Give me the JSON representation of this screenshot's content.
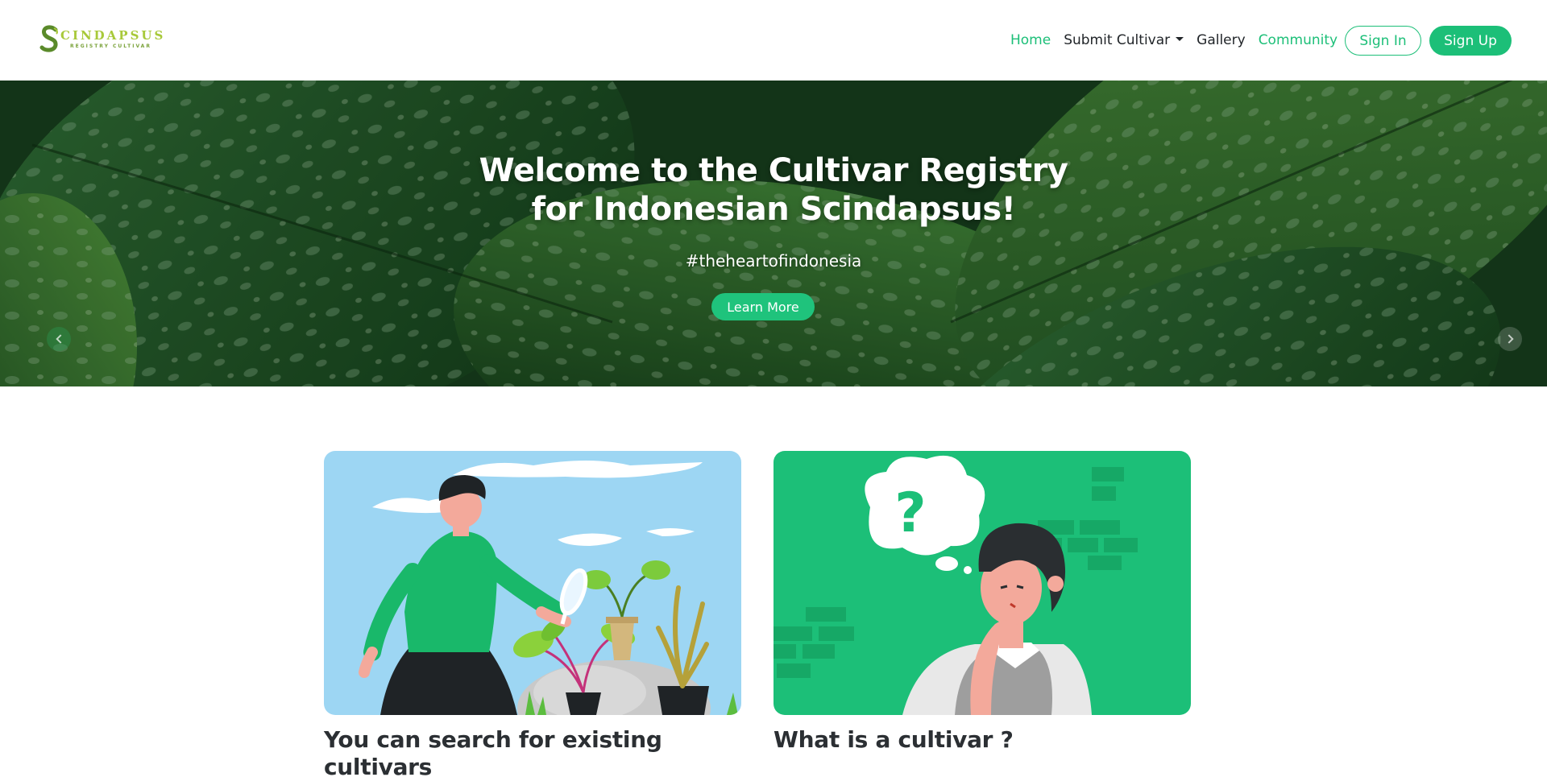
{
  "brand": {
    "name": "SCINDAPSUS",
    "word": "CINDAPSUS",
    "subtitle": "REGISTRY CULTIVAR",
    "accent": "#1cbf78",
    "logo_green": "#a8c93a"
  },
  "nav": {
    "home": "Home",
    "submit_cultivar": "Submit Cultivar",
    "gallery": "Gallery",
    "community": "Community",
    "sign_in": "Sign In",
    "sign_up": "Sign Up"
  },
  "hero": {
    "title_line1": "Welcome to the Cultivar Registry",
    "title_line2": "for Indonesian Scindapsus!",
    "tagline": "#theheartofindonesia",
    "cta": "Learn More"
  },
  "cards": [
    {
      "title": "You can search for existing cultivars",
      "image": "person-with-magnifying-glass-and-plants"
    },
    {
      "title": "What is a cultivar ?",
      "image": "person-thinking-with-question-bubble"
    }
  ],
  "icons": {
    "dropdown": "caret-down-icon",
    "carousel_prev": "chevron-left-icon",
    "carousel_next": "chevron-right-icon"
  }
}
